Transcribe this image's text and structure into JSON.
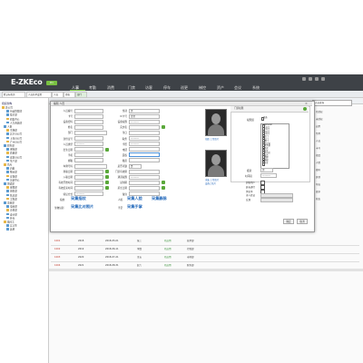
{
  "app": {
    "brand": "E-ZKEco",
    "badge": "Pro"
  },
  "nav": [
    "人事",
    "考勤",
    "消费",
    "门禁",
    "访客",
    "停车",
    "巡更",
    "梯控",
    "资产",
    "会议",
    "系统"
  ],
  "tabs": [
    "默认标签页",
    "人员名单设置",
    "人员",
    "授权",
    "部门"
  ],
  "sidebar": {
    "header": "组织架构",
    "items": [
      "总公司",
      "行政管理部",
      "技术部",
      "研发中心",
      "人力资源部",
      "人事",
      "市场部",
      "北京分公司",
      "上海分公司",
      "广州分公司",
      "财务部",
      "采购部",
      "质量部",
      "深圳分公司",
      "生产部",
      "仓库",
      "后勤",
      "物业部",
      "安保部",
      "培训中心",
      "测试部",
      "客服部",
      "销售部",
      "售后部",
      "工程部",
      "项目部",
      "电商部",
      "企划部",
      "设计部",
      "外包",
      "临时工",
      "实习生",
      "其他"
    ]
  },
  "right_panel": {
    "search_placeholder": "人员查询",
    "items": [
      "已授权",
      "未授权",
      "启用",
      "禁用",
      "人员",
      "卡号",
      "指纹",
      "人脸",
      "密码",
      "其他",
      "导出",
      "更多",
      "状态"
    ]
  },
  "dialog": {
    "title": "编辑 人员",
    "left_labels": [
      "人员编号",
      "卡号",
      "设备密码",
      "姓名",
      "部门",
      "身份证号",
      "人员类型",
      "出生日期",
      "手机",
      "邮箱",
      "车牌号码",
      "离职日期",
      "入职日期",
      "有效开始时间",
      "有效结束时间",
      "验证方式"
    ],
    "right_labels": [
      "性别",
      "IC卡号",
      "设备权限",
      "英文名",
      "生日",
      "职务",
      "学历",
      "电话",
      "民族",
      "籍贯",
      "是否考勤",
      "门禁有效期",
      "通道权限",
      "试用期",
      "延长日期",
      "备注"
    ],
    "values": {
      "gender": "男",
      "card_status": "正常",
      "select_default": "----------",
      "attendance": "是"
    },
    "photo_link_1": "拍照  上传照片",
    "photo_link_2": "采集  上传照片",
    "photo_link_3": "设备上照片",
    "capture_fingerprint": "采集指纹",
    "capture_face": "采集人脸",
    "capture_palm": "采集静脉",
    "capture_compare": "采集比对照片",
    "capture_hand": "采集手掌",
    "capture_extra": "采集手掌",
    "label_fp": "指纹",
    "label_face": "人脸",
    "label_bio": "生物识别",
    "label_palm": "手掌"
  },
  "permissions": {
    "header": "门禁权限",
    "label_group": "权限组",
    "select_all": "全选",
    "options": [
      "general",
      "1号门",
      "2号门",
      "3号门",
      "4号门",
      "大门",
      "后门",
      "侧门",
      "会议室",
      "财务室",
      "机房",
      "仓库",
      "办公区",
      "前台",
      "走廊",
      "电梯",
      "车库"
    ],
    "label_level": "级别",
    "label_time": "时间段",
    "label_super": "超级用户",
    "label_extend": "延长通行",
    "label_blacklist": "黑名单",
    "label_multi": "多人验证",
    "label_ap": "反潜"
  },
  "buttons": {
    "ok": "确定",
    "cancel": "取消"
  },
  "rows": [
    {
      "id": "1001",
      "name": "张三",
      "card": "2018",
      "dept": "技术部",
      "status": "已启用",
      "date": "2018-05-01"
    },
    {
      "id": "1002",
      "name": "李四",
      "card": "2019",
      "dept": "行政部",
      "status": "已启用",
      "date": "2018-06-11"
    },
    {
      "id": "1003",
      "name": "王五",
      "card": "2020",
      "dept": "市场部",
      "status": "已启用",
      "date": "2018-07-21"
    },
    {
      "id": "1004",
      "name": "赵六",
      "card": "2021",
      "dept": "财务部",
      "status": "已启用",
      "date": "2018-08-31"
    }
  ],
  "colors": {
    "topbar": "#3e4247",
    "accent": "#7ac142",
    "link": "#2266bb",
    "calendar": "#5aa83a"
  }
}
